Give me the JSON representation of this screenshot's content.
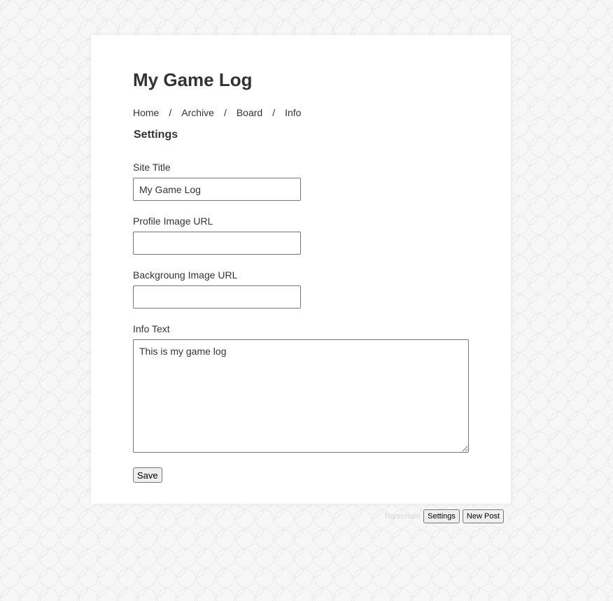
{
  "header": {
    "title": "My Game Log"
  },
  "nav": {
    "items": [
      "Home",
      "Archive",
      "Board",
      "Info"
    ],
    "separator": "/"
  },
  "page": {
    "section_title": "Settings"
  },
  "form": {
    "site_title": {
      "label": "Site Title",
      "value": "My Game Log",
      "placeholder": ""
    },
    "profile_image_url": {
      "label": "Profile Image URL",
      "value": "",
      "placeholder": ""
    },
    "background_image_url": {
      "label": "Backgroung Image URL",
      "value": "",
      "placeholder": ""
    },
    "info_text": {
      "label": "Info Text",
      "value": "This is my game log"
    },
    "save_label": "Save"
  },
  "footer": {
    "brand": "Toyscreen",
    "settings_label": "Settings",
    "new_post_label": "New Post"
  },
  "colors": {
    "background": "#f7f7f7",
    "card": "#ffffff",
    "text": "#333333",
    "input_border": "#767676"
  }
}
